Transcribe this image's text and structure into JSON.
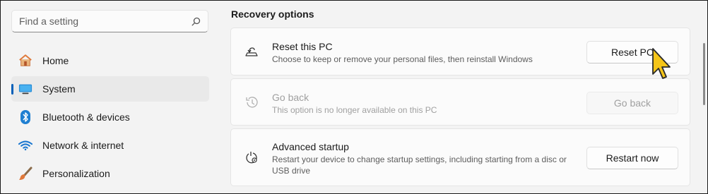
{
  "search": {
    "placeholder": "Find a setting",
    "icon": "search-icon"
  },
  "sidebar": {
    "items": [
      {
        "label": "Home",
        "icon": "home-icon",
        "selected": false
      },
      {
        "label": "System",
        "icon": "system-monitor-icon",
        "selected": true
      },
      {
        "label": "Bluetooth & devices",
        "icon": "bluetooth-icon",
        "selected": false
      },
      {
        "label": "Network & internet",
        "icon": "wifi-icon",
        "selected": false
      },
      {
        "label": "Personalization",
        "icon": "paintbrush-icon",
        "selected": false
      }
    ]
  },
  "main": {
    "section_title": "Recovery options",
    "cards": [
      {
        "title": "Reset this PC",
        "description": "Choose to keep or remove your personal files, then reinstall Windows",
        "button": "Reset PC",
        "icon": "reset-pc-icon",
        "enabled": true
      },
      {
        "title": "Go back",
        "description": "This option is no longer available on this PC",
        "button": "Go back",
        "icon": "history-icon",
        "enabled": false
      },
      {
        "title": "Advanced startup",
        "description": "Restart your device to change startup settings, including starting from a disc or USB drive",
        "button": "Restart now",
        "icon": "advanced-startup-icon",
        "enabled": true
      }
    ]
  },
  "colors": {
    "accent": "#005fb8",
    "cursor": "#f5c518"
  }
}
